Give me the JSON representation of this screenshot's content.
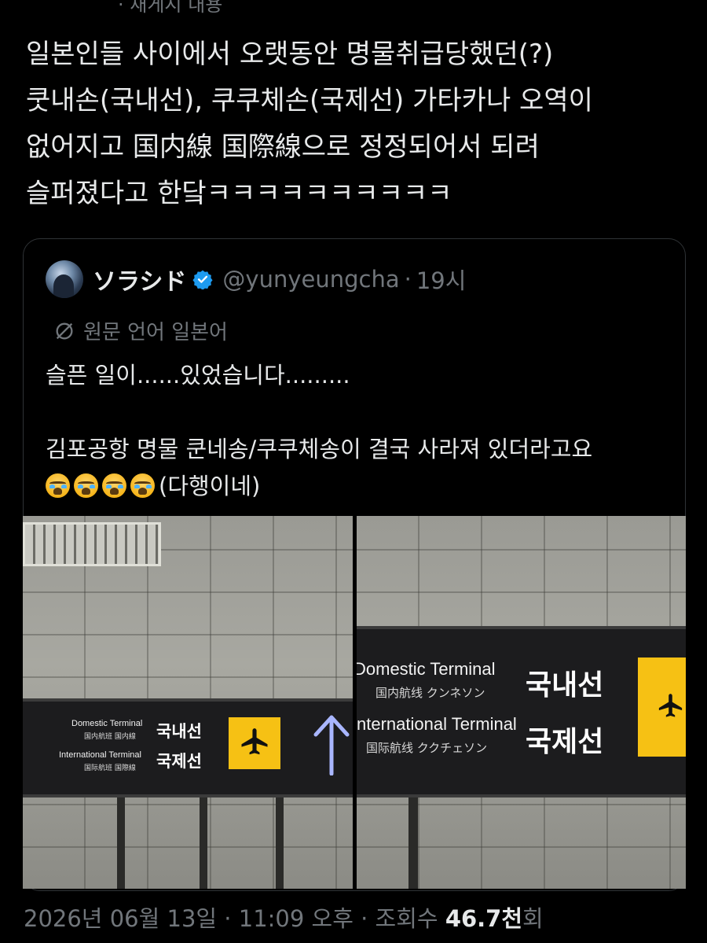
{
  "top_cut_text": "· 재게시 내용",
  "post": {
    "lines": [
      "일본인들 사이에서 오랫동안 명물취급당했던(?)",
      "쿳내손(국내선), 쿠쿠체손(국제선) 가타카나 오역이",
      "없어지고 国内線 国際線으로 정정되어서 되려",
      "슬퍼졌다고 한닼ㅋㅋㅋㅋㅋㅋㅋㅋㅋㅋ"
    ]
  },
  "quote": {
    "display_name": "ソラシド",
    "handle": "@yunyeungcha",
    "separator": "·",
    "time": "19시",
    "translate_label": "원문 언어 일본어",
    "text_line1": "슬픈 일이......있었습니다.........",
    "text_line2": "김포공항 명물 쿤네송/쿠쿠체송이 결국 사라져 있더라고요",
    "text_line3_suffix": "(다행이네)",
    "emoji_name": "loudly-crying-face-icon",
    "emoji_count": 4,
    "photo_left": {
      "domestic_en": "Domestic Terminal",
      "domestic_sub": "国内航班 国内線",
      "domestic_ko": "국내선",
      "international_en": "International Terminal",
      "international_sub": "国际航班 国際線",
      "international_ko": "국제선"
    },
    "photo_right": {
      "domestic_en": "Domestic Terminal",
      "domestic_sub": "国内航线 クンネソン",
      "domestic_ko": "국내선",
      "international_en": "nternational Terminal",
      "international_sub": "国际航线 ククチェソン",
      "international_ko": "국제선"
    }
  },
  "meta": {
    "date_time": "2026년 06월 13일 · 11:09 오후 · 조회수 ",
    "views_num": "46.7천",
    "views_suffix": "회"
  },
  "colors": {
    "background": "#000000",
    "text": "#e7e9ea",
    "secondary": "#71767b",
    "verified_blue": "#1d9bf0",
    "sign_yellow": "#f6c114"
  }
}
